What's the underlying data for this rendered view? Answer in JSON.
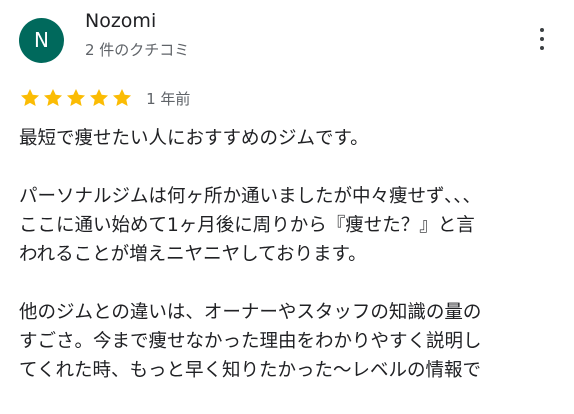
{
  "review": {
    "author": {
      "initial": "N",
      "name": "Nozomi",
      "review_count": "2 件のクチコミ"
    },
    "menu_icon": "more-vert-icon",
    "rating": {
      "stars": 5,
      "max": 5,
      "star_color": "#fbbc04"
    },
    "date": "1 年前",
    "paragraphs": [
      [
        "最短で痩せたい人におすすめのジムです。"
      ],
      [
        "パーソナルジムは何ヶ所か通いましたが中々痩せず､､､",
        "ここに通い始めて1ヶ月後に周りから『痩せた？』と言",
        "われることが増えニヤニヤしております。"
      ],
      [
        "他のジムとの違いは、オーナーやスタッフの知識の量の",
        "すごさ。今まで痩せなかった理由をわかりやすく説明し",
        "てくれた時、もっと早く知りたかった〜レベルの情報で"
      ]
    ]
  }
}
